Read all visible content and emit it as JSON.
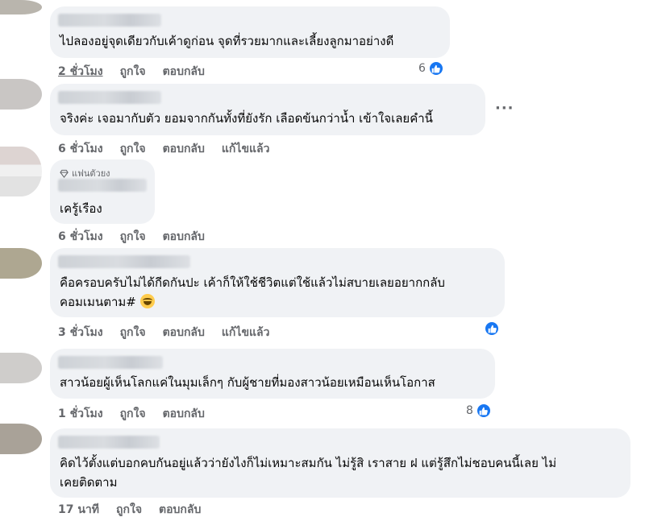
{
  "colors": {
    "bubble": "#f0f2f5",
    "meta_text": "#65676b",
    "like_blue": "#1877f2"
  },
  "comments": [
    {
      "avatar_color": "#b9b5ad",
      "text": "ไปลองอยู่จุดเดียวกับเค้าดูก่อน จุดที่รวยมากและเลี้ยงลูกมาอย่างดี",
      "time": "2 ชั่วโมง",
      "like": "ถูกใจ",
      "reply": "ตอบกลับ",
      "reactions": "6"
    },
    {
      "avatar_color": "#c9c6c4",
      "text": "จริงค่ะ เจอมากับตัว ยอมจากกันทั้งที่ยังรัก เลือดข้นกว่าน้ำ เข้าใจเลยคำนี้",
      "time": "6 ชั่วโมง",
      "like": "ถูกใจ",
      "reply": "ตอบกลับ",
      "edited": "แก้ไขแล้ว",
      "more": "···"
    },
    {
      "avatar_color": "#ddd4d2",
      "badge": "แฟนตัวยง",
      "text": "เครู้เรือง",
      "time": "6 ชั่วโมง",
      "like": "ถูกใจ",
      "reply": "ตอบกลับ"
    },
    {
      "avatar_color": "#aea791",
      "text_lines": [
        "คือครอบครับไม่ได้กีดกันปะ เค้าก็ให้ใช้ชีวิตแต่ใช้แล้วไม่สบายเลยอยากกลับ",
        "คอมเมนตาม#"
      ],
      "time": "3 ชั่วโมง",
      "like": "ถูกใจ",
      "reply": "ตอบกลับ",
      "edited": "แก้ไขแล้ว"
    },
    {
      "avatar_color": "#cfcdcb",
      "text": "สาวน้อยผู้เห็นโลกแค่ในมุมเล็กๆ กับผู้ชายที่มองสาวน้อยเหมือนเห็นโอกาส",
      "time": "1 ชั่วโมง",
      "like": "ถูกใจ",
      "reply": "ตอบกลับ",
      "reactions": "8"
    },
    {
      "avatar_color": "#a9a298",
      "text_lines": [
        "คิดไว้ตั้งแต่บอกคบกันอยู่แล้วว่ายังไงก็ไม่เหมาะสมกัน ไม่รู้สิ เราสาย ฝ แต่รู้สึกไม่ชอบคนนี้เลย ไม่",
        "เคยติดตาม"
      ],
      "time": "17 นาที",
      "like": "ถูกใจ",
      "reply": "ตอบกลับ"
    }
  ]
}
